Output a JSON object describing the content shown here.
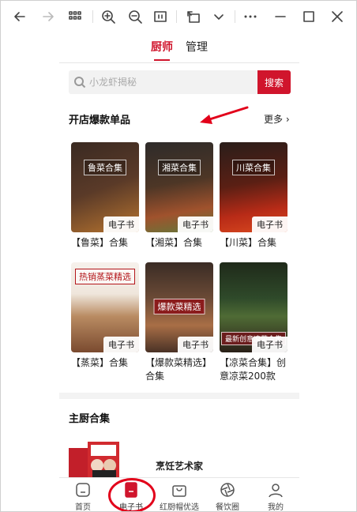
{
  "tabs": [
    {
      "label": "厨师",
      "active": true
    },
    {
      "label": "管理",
      "active": false
    }
  ],
  "search": {
    "placeholder": "小龙虾揭秘",
    "button_label": "搜索"
  },
  "hot_section": {
    "title": "开店爆款单品",
    "more_label": "更多"
  },
  "items": [
    {
      "title": "【鲁菜】合集",
      "badge": "电子书",
      "cover_text": "鲁菜合集"
    },
    {
      "title": "【湘菜】合集",
      "badge": "电子书",
      "cover_text": "湘菜合集"
    },
    {
      "title": "【川菜】合集",
      "badge": "电子书",
      "cover_text": "川菜合集"
    },
    {
      "title": "【蒸菜】合集",
      "badge": "电子书",
      "cover_text": "热销蒸菜精选"
    },
    {
      "title": "【爆款菜精选】合集",
      "badge": "电子书",
      "cover_text": "爆款菜精选"
    },
    {
      "title": "【凉菜合集】创意凉菜200款",
      "badge": "电子书",
      "cover_text": "最新创意凉菜合集"
    }
  ],
  "chef_section": {
    "title": "主厨合集",
    "collection_name": "烹饪艺术家"
  },
  "bottom_nav": [
    {
      "label": "首页",
      "icon": "home-icon"
    },
    {
      "label": "电子书",
      "icon": "ebook-icon",
      "active": true
    },
    {
      "label": "红厨帽优选",
      "icon": "bag-icon"
    },
    {
      "label": "餐饮圈",
      "icon": "aperture-icon"
    },
    {
      "label": "我的",
      "icon": "user-icon"
    }
  ],
  "colors": {
    "accent": "#d0152c",
    "annotation": "#e2001a"
  }
}
